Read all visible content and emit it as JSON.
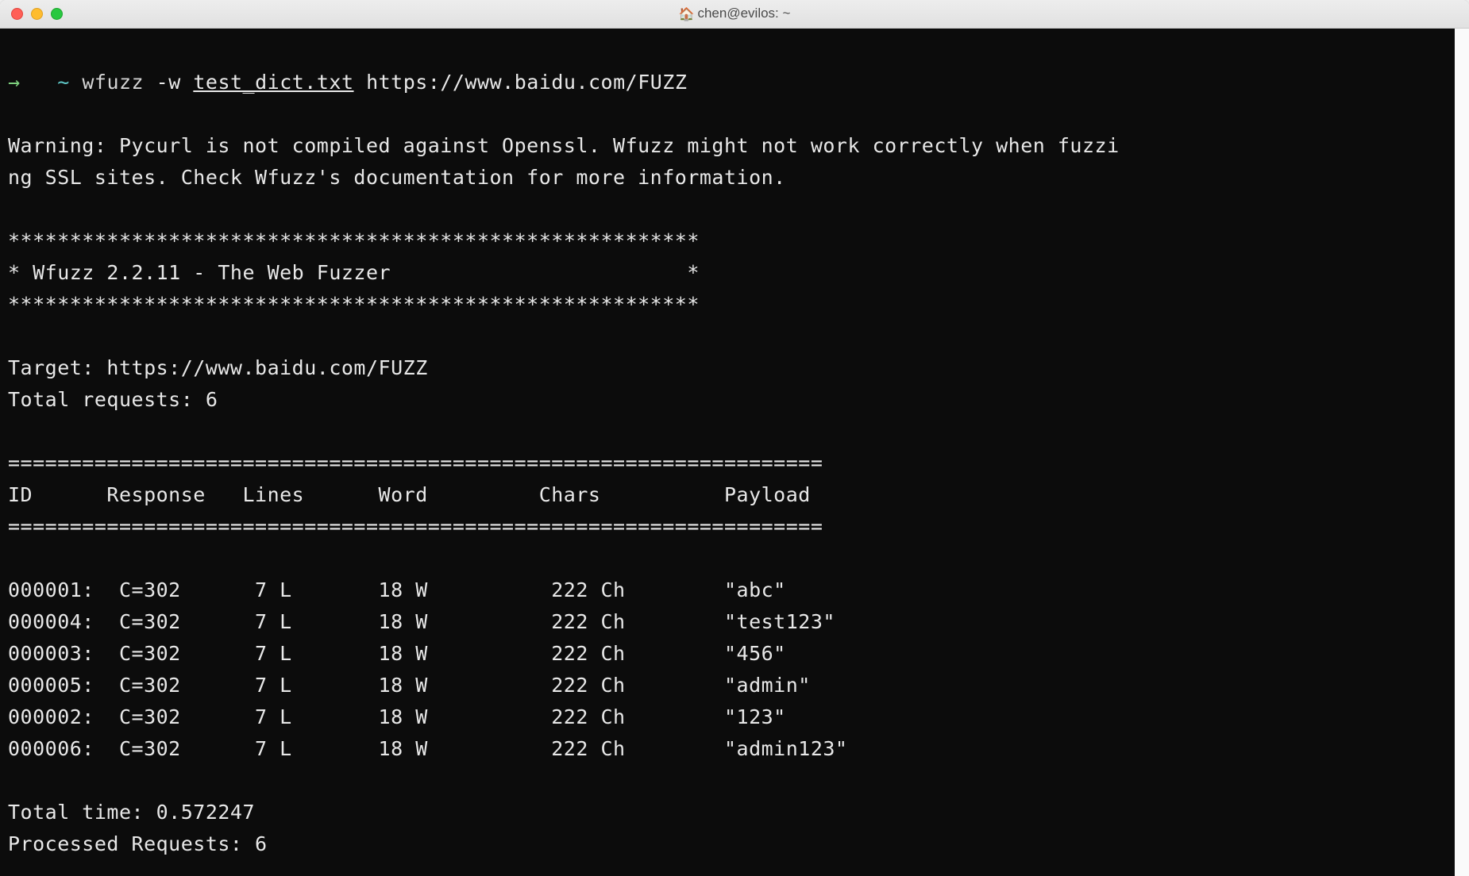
{
  "window": {
    "title": "chen@evilos: ~"
  },
  "prompt": {
    "arrow": "→",
    "tilde": "~",
    "command": "wfuzz",
    "flag": "-w",
    "arg_file": "test_dict.txt",
    "arg_url": "https://www.baidu.com/FUZZ"
  },
  "warning": "Warning: Pycurl is not compiled against Openssl. Wfuzz might not work correctly when fuzzi\nng SSL sites. Check Wfuzz's documentation for more information.",
  "banner": {
    "stars_top": "********************************************************",
    "line": "* Wfuzz 2.2.11 - The Web Fuzzer                        *",
    "stars_bot": "********************************************************"
  },
  "target_line": "Target: https://www.baidu.com/FUZZ",
  "total_requests_line": "Total requests: 6",
  "separator": "==================================================================",
  "header": "ID      Response   Lines      Word         Chars          Payload",
  "rows": [
    {
      "text": "000001:  C=302      7 L       18 W          222 Ch        \"abc\""
    },
    {
      "text": "000004:  C=302      7 L       18 W          222 Ch        \"test123\""
    },
    {
      "text": "000003:  C=302      7 L       18 W          222 Ch        \"456\""
    },
    {
      "text": "000005:  C=302      7 L       18 W          222 Ch        \"admin\""
    },
    {
      "text": "000002:  C=302      7 L       18 W          222 Ch        \"123\""
    },
    {
      "text": "000006:  C=302      7 L       18 W          222 Ch        \"admin123\""
    }
  ],
  "footer": {
    "total_time": "Total time: 0.572247",
    "processed": "Processed Requests: 6"
  }
}
